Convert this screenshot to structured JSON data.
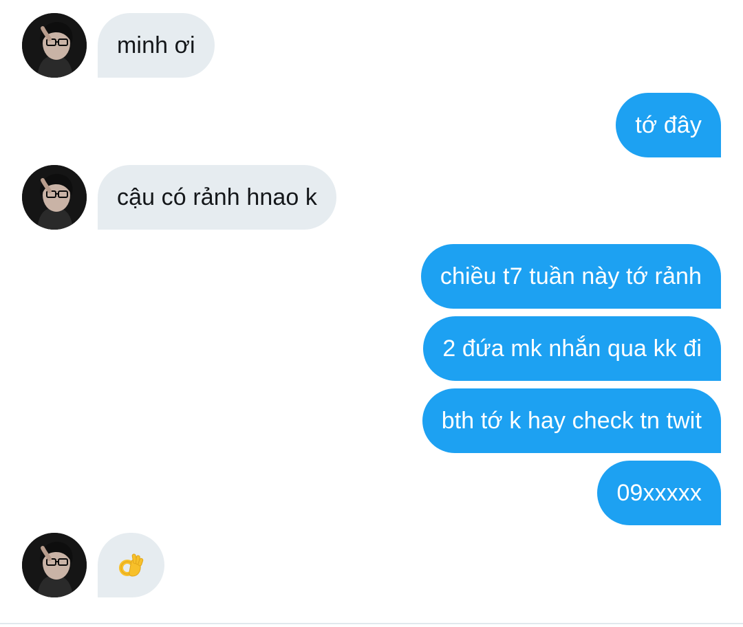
{
  "conversation": {
    "messages": [
      {
        "from": "them",
        "text": "minh ơi"
      },
      {
        "from": "me",
        "text": "tớ đây"
      },
      {
        "from": "them",
        "text": "cậu có rảnh hnao k"
      },
      {
        "from": "me",
        "text": "chiều t7 tuần này tớ rảnh"
      },
      {
        "from": "me",
        "text": "2 đứa mk nhắn qua kk đi"
      },
      {
        "from": "me",
        "text": "bth tớ k hay check tn twit"
      },
      {
        "from": "me",
        "text": "09xxxxx"
      },
      {
        "from": "them",
        "text": "",
        "emoji": "ok-hand-emoji"
      }
    ]
  },
  "colors": {
    "incoming_bubble": "#e6ecf0",
    "outgoing_bubble": "#1da1f2",
    "incoming_text": "#14171a",
    "outgoing_text": "#ffffff"
  }
}
